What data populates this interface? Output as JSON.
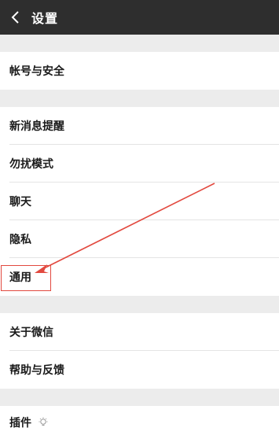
{
  "header": {
    "title": "设置",
    "back_icon": "chevron-left-icon"
  },
  "sections": {
    "account": {
      "label": "帐号与安全"
    },
    "new_message": {
      "label": "新消息提醒"
    },
    "dnd": {
      "label": "勿扰模式"
    },
    "chat": {
      "label": "聊天"
    },
    "privacy": {
      "label": "隐私"
    },
    "general": {
      "label": "通用"
    },
    "about": {
      "label": "关于微信"
    },
    "help": {
      "label": "帮助与反馈"
    },
    "plugins": {
      "label": "插件",
      "icon": "bulb-icon"
    }
  },
  "annotation": {
    "color": "#e2493f"
  },
  "colors": {
    "header_bg": "#2e2e2e",
    "page_bg": "#ececec",
    "row_bg": "#ffffff"
  }
}
